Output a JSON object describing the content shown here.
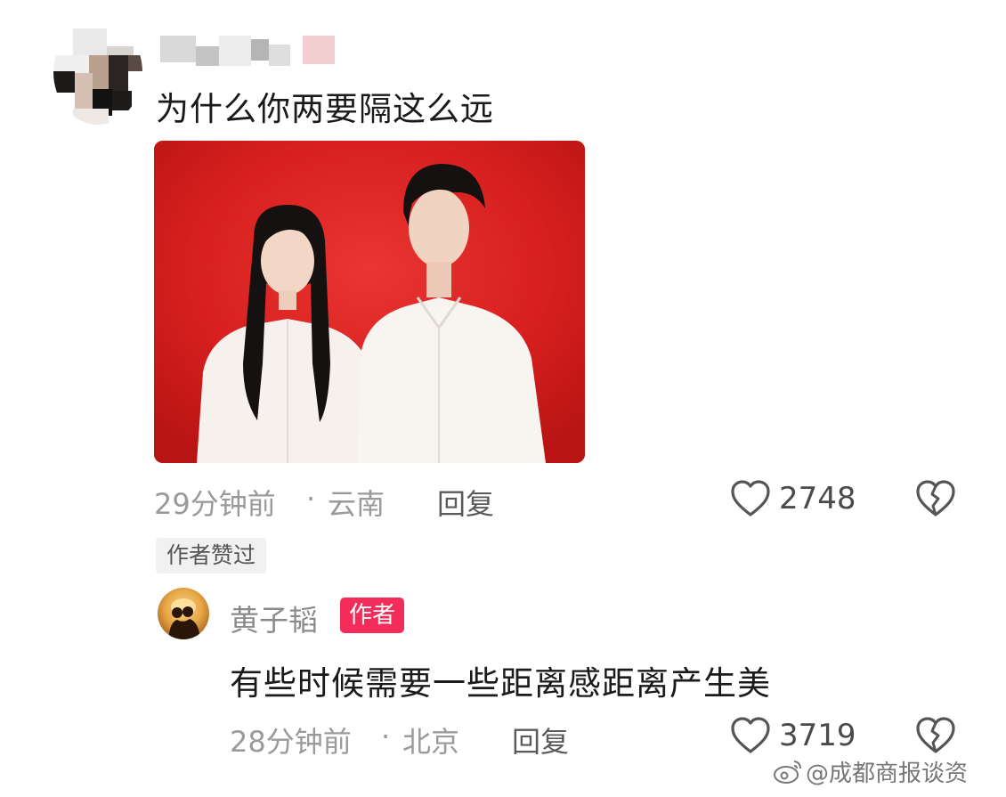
{
  "comment": {
    "text": "为什么你两要隔这么远",
    "time": "29分钟前",
    "separator": "·",
    "location": "云南",
    "reply_label": "回复",
    "like_count": "2748",
    "liked_by_author_tag": "作者赞过"
  },
  "reply": {
    "username": "黄子韬",
    "badge": "作者",
    "text": "有些时候需要一些距离感距离产生美",
    "time": "28分钟前",
    "separator": "·",
    "location": "北京",
    "reply_label": "回复",
    "like_count": "3719"
  },
  "watermark": "@成都商报谈资",
  "colors": {
    "photo_background": "#d8201f",
    "author_badge": "#f42c5a",
    "meta_text": "#9a9a9a"
  },
  "icons": [
    "heart-outline-icon",
    "broken-heart-icon",
    "weibo-icon"
  ]
}
